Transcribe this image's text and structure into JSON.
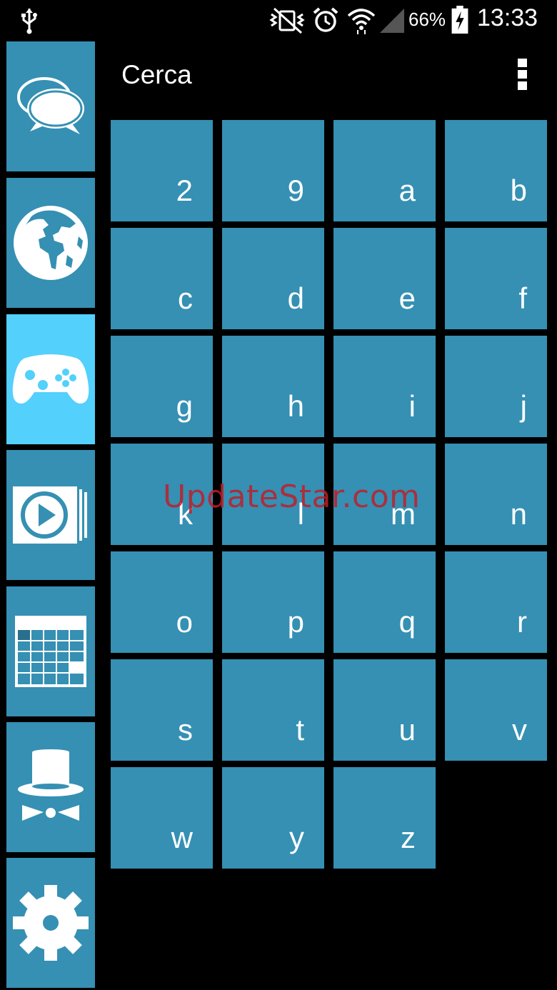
{
  "status_bar": {
    "battery_percent": "66%",
    "time": "13:33",
    "icons": [
      "usb-icon",
      "vibrate-icon",
      "alarm-icon",
      "wifi-icon",
      "signal-icon",
      "battery-charging-icon"
    ]
  },
  "sidebar": {
    "items": [
      {
        "name": "messages",
        "icon": "chat-bubbles-icon",
        "active": false
      },
      {
        "name": "internet",
        "icon": "globe-icon",
        "active": false
      },
      {
        "name": "games",
        "icon": "gamepad-icon",
        "active": true
      },
      {
        "name": "media",
        "icon": "play-icon",
        "active": false
      },
      {
        "name": "calendar",
        "icon": "calendar-icon",
        "active": false
      },
      {
        "name": "tools",
        "icon": "top-hat-bowtie-icon",
        "active": false
      },
      {
        "name": "settings",
        "icon": "gear-icon",
        "active": false
      }
    ]
  },
  "header": {
    "title": "Cerca",
    "menu_icon": "overflow-menu-icon"
  },
  "grid": {
    "letters": [
      "2",
      "9",
      "a",
      "b",
      "c",
      "d",
      "e",
      "f",
      "g",
      "h",
      "i",
      "j",
      "k",
      "l",
      "m",
      "n",
      "o",
      "p",
      "q",
      "r",
      "s",
      "t",
      "u",
      "v",
      "w",
      "y",
      "z"
    ]
  },
  "watermark": "UpdateStar.com",
  "colors": {
    "tile": "#3590b3",
    "active_tile": "#53d0fb",
    "background": "#000000",
    "watermark": "#be1e28"
  }
}
